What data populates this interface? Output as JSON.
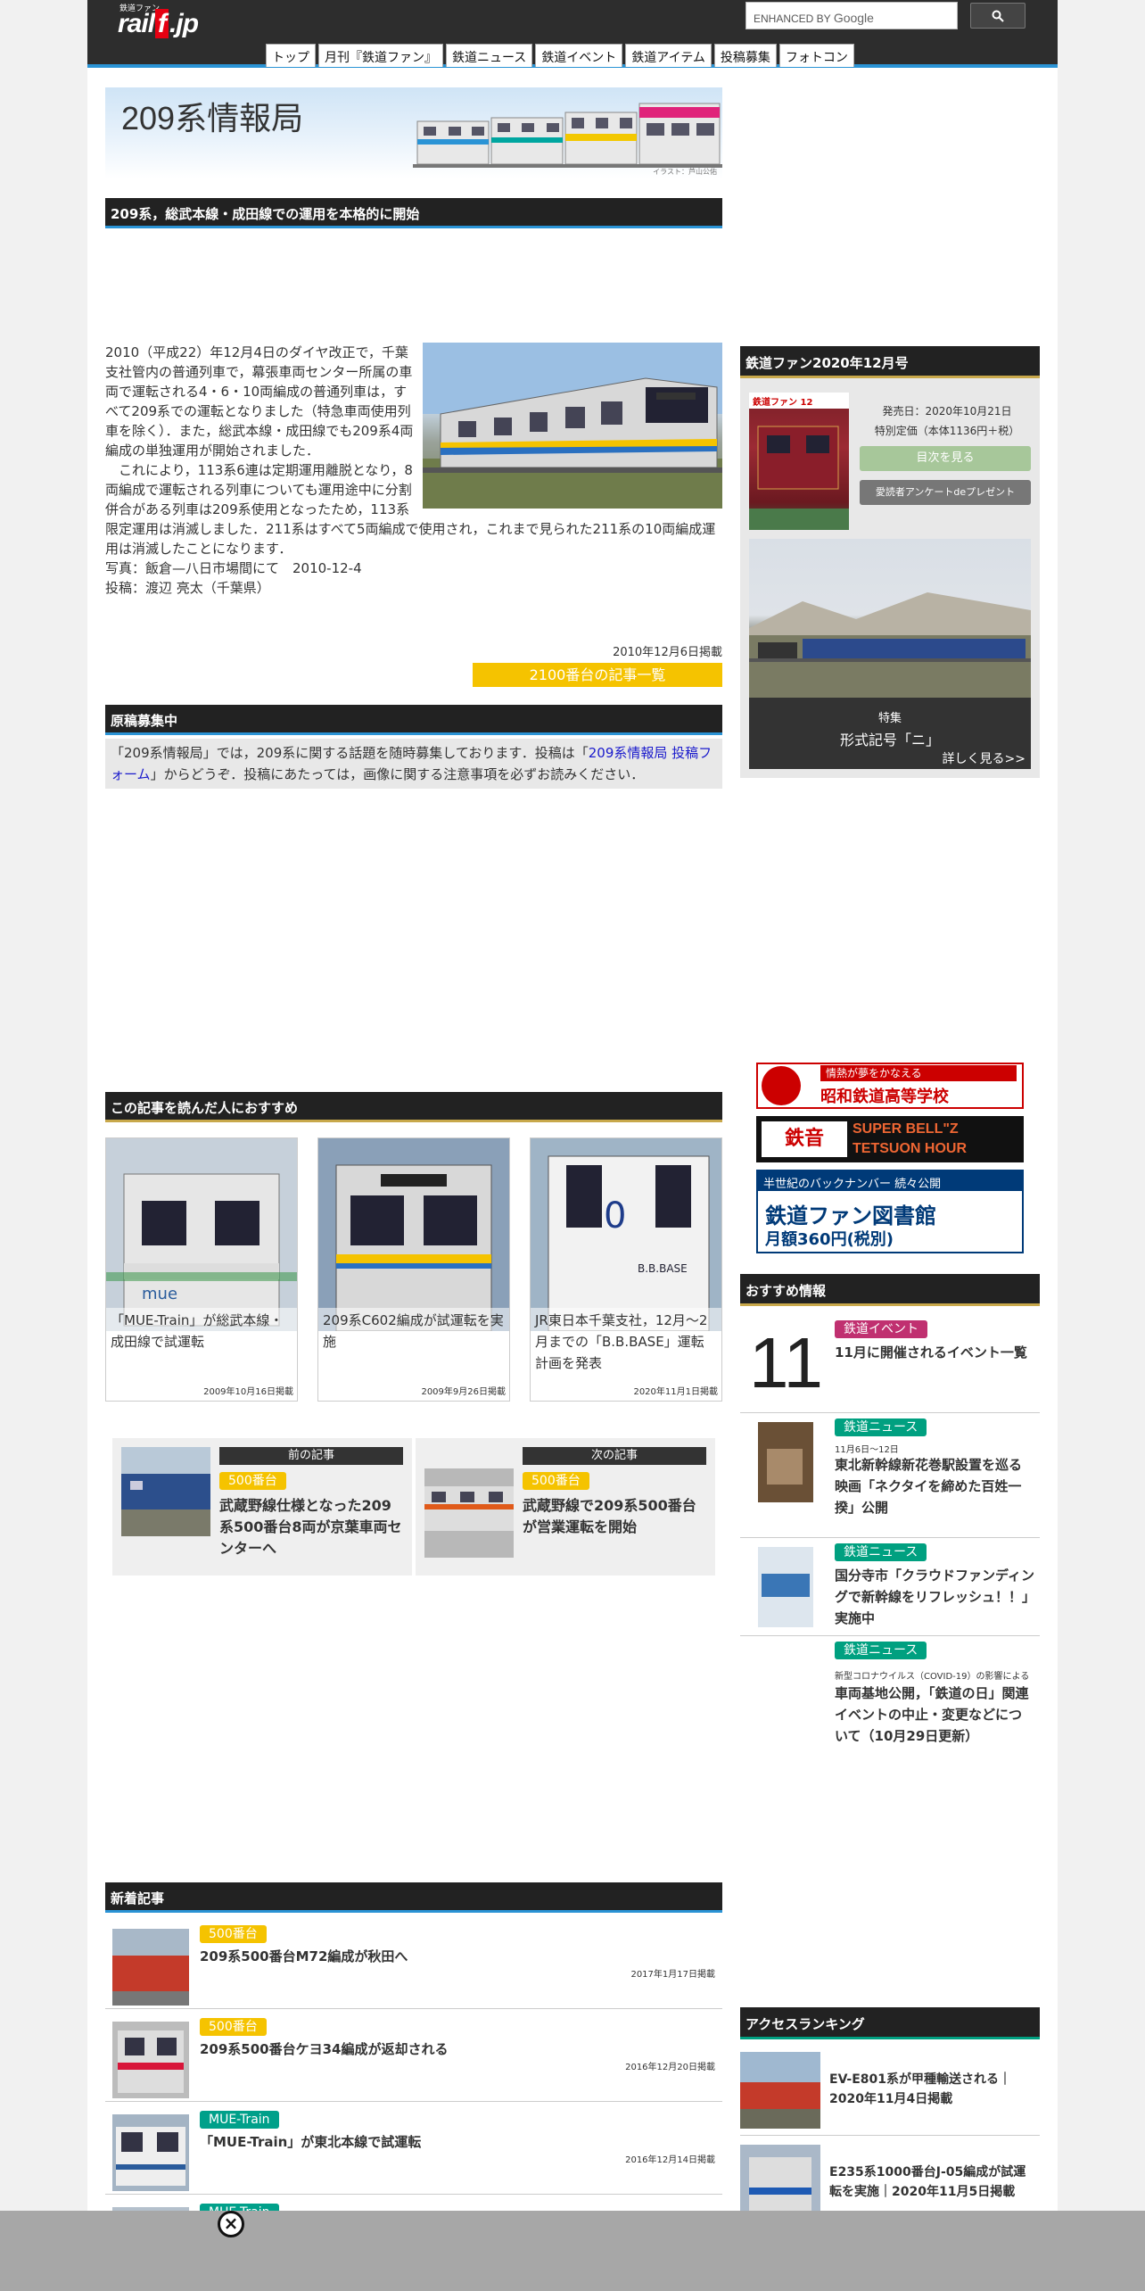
{
  "header": {
    "logo_small": "鉄道ファン",
    "logo_pre": "rail",
    "logo_f": "f",
    "logo_post": ".jp",
    "search_placeholder": "ENHANCED BY",
    "search_brand": "Google",
    "nav": [
      "トップ",
      "月刊『鉄道ファン』",
      "鉄道ニュース",
      "鉄道イベント",
      "鉄道アイテム",
      "投稿募集",
      "フォトコン"
    ]
  },
  "banner": {
    "title": "209系情報局",
    "credit": "イラスト：芦山公佑"
  },
  "article": {
    "headline": "209系，総武本線・成田線での運用を本格的に開始",
    "para1": "2010（平成22）年12月4日のダイヤ改正で，千葉支社管内の普通列車で，幕張車両センター所属の車両で運転される4・6・10両編成の普通列車は，すべて209系での運転となりました（特急車両使用列車を除く）．また，総武本線・成田線でも209系4両編成の単独運用が開始されました．",
    "para2": "　これにより，113系6連は定期運用離脱となり，8両編成で運転される列車についても運用途中に分割併合がある列車は209系使用となったため，113系限定運用は消滅しました．211系はすべて5両編成で使用され，これまで見られた211系の10両編成運用は消滅したことになります．",
    "photo": "写真：飯倉—八日市場間にて　2010-12-4",
    "contributor": "投稿：渡辺 亮太（千葉県）",
    "date": "2010年12月6日掲載",
    "list_button": "2100番台の記事一覧"
  },
  "recruit": {
    "heading": "原稿募集中",
    "text1": "「209系情報局」では，209系に関する話題を随時募集しております．投稿は「",
    "link": "209系情報局 投稿フォーム",
    "text2": "」からどうぞ．投稿にあたっては，画像に関する注意事項を必ずお読みください．"
  },
  "recommend": {
    "heading": "この記事を読んだ人におすすめ",
    "cards": [
      {
        "title": "「MUE-Train」が総武本線・成田線で試運転",
        "date": "2009年10月16日掲載"
      },
      {
        "title": "209系C602編成が試運転を実施",
        "date": "2009年9月26日掲載"
      },
      {
        "title": "JR東日本千葉支社，12月〜2月までの「B.B.BASE」運転計画を発表",
        "date": "2020年11月1日掲載"
      }
    ]
  },
  "prevnext": {
    "prev": {
      "label": "前の記事",
      "badge": "500番台",
      "title": "武蔵野線仕様となった209系500番台8両が京葉車両センターへ"
    },
    "next": {
      "label": "次の記事",
      "badge": "500番台",
      "title": "武蔵野線で209系500番台が営業運転を開始"
    }
  },
  "new_articles": {
    "heading": "新着記事",
    "items": [
      {
        "badge": "500番台",
        "title": "209系500番台M72編成が秋田へ",
        "date": "2017年1月17日掲載"
      },
      {
        "badge": "500番台",
        "title": "209系500番台ケヨ34編成が返却される",
        "date": "2016年12月20日掲載"
      },
      {
        "badge": "MUE-Train",
        "title": "「MUE-Train」が東北本線で試運転",
        "date": "2016年12月14日掲載"
      },
      {
        "badge": "MUE-Train"
      }
    ]
  },
  "magazine": {
    "heading": "鉄道ファン2020年12月号",
    "issue_no": "12",
    "release": "発売日：2020年10月21日",
    "price": "特別定価（本体1136円＋税）",
    "toc_button": "目次を見る",
    "present_button": "愛読者アンケートdeプレゼント",
    "feature_label": "特集",
    "feature_title": "形式記号「ニ」",
    "more": "詳しく見る>>"
  },
  "ads": {
    "ad1_line1": "情熱が夢をかなえる",
    "ad1_line2": "昭和鉄道高等学校",
    "ad2_text": "SUPER BELL\"Z TETSUON HOUR",
    "ad3_line1": "半世紀のバックナンバー 続々公開",
    "ad3_line2": "鉄道ファン図書館",
    "ad3_line3": "月額360円(税別)"
  },
  "recinfo": {
    "heading": "おすすめ情報",
    "items": [
      {
        "badge": "鉄道イベント",
        "num": "11",
        "title": "11月に開催されるイベント一覧"
      },
      {
        "badge": "鉄道ニュース",
        "small": "11月6日〜12日",
        "title": "東北新幹線新花巻駅設置を巡る映画「ネクタイを締めた百姓一揆」公開"
      },
      {
        "badge": "鉄道ニュース",
        "title": "国分寺市「クラウドファンディングで新幹線をリフレッシュ！！」実施中"
      },
      {
        "badge": "鉄道ニュース",
        "small": "新型コロナウイルス（COVID-19）の影響による",
        "title": "車両基地公開，「鉄道の日」関連イベントの中止・変更などについて（10月29日更新）"
      }
    ]
  },
  "ranking": {
    "heading": "アクセスランキング",
    "items": [
      {
        "title": "EV-E801系が甲種輸送される｜2020年11月4日掲載"
      },
      {
        "title": "E235系1000番台J-05編成が試運転を実施｜2020年11月5日掲載"
      }
    ]
  },
  "colors": {
    "accent_blue": "#2a93d5",
    "gold": "#c8a84b",
    "yellow": "#f5c300",
    "teal": "#00a08a"
  }
}
